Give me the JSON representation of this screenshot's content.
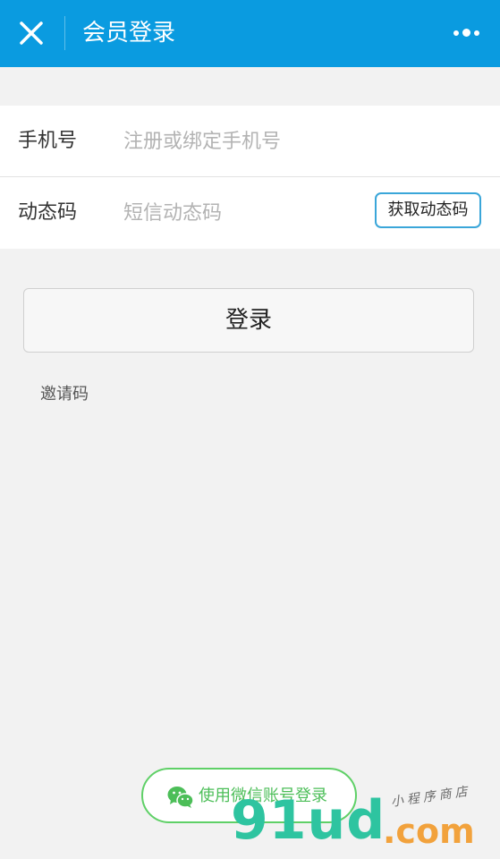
{
  "header": {
    "title": "会员登录",
    "close_icon": "close-icon",
    "more_icon": "more-dots-icon",
    "background": "#0a9be0"
  },
  "form": {
    "phone": {
      "label": "手机号",
      "placeholder": "注册或绑定手机号",
      "value": ""
    },
    "code": {
      "label": "动态码",
      "placeholder": "短信动态码",
      "value": "",
      "button_label": "获取动态码"
    }
  },
  "login_button": "登录",
  "invite_link": "邀请码",
  "wechat_login": {
    "label": "使用微信账号登录",
    "icon": "wechat-icon",
    "color": "#4cbe58"
  },
  "watermark": {
    "brand": "91ud",
    "domain": ".com",
    "tagline": "小程序商店"
  }
}
